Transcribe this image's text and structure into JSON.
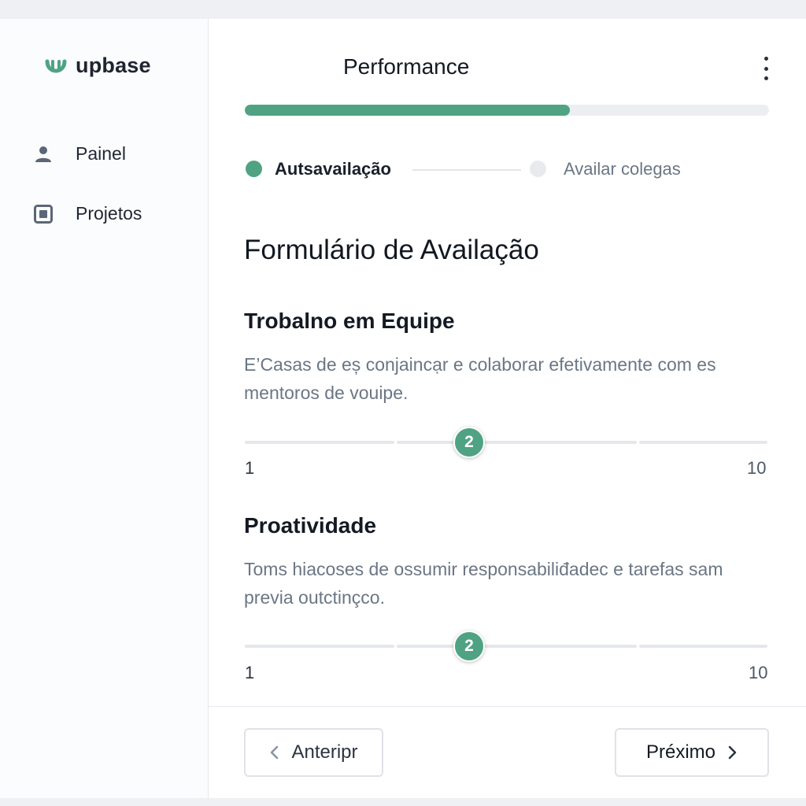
{
  "brand": {
    "name": "upbase",
    "accent": "#4fa383"
  },
  "sidebar": {
    "items": [
      {
        "label": "Painel",
        "icon": "user-icon"
      },
      {
        "label": "Projetos",
        "icon": "square-icon"
      }
    ]
  },
  "header": {
    "title": "Performance",
    "menu_icon": "kebab-menu-icon"
  },
  "progress": {
    "value_percent": 62,
    "color": "#4fa383"
  },
  "steps": [
    {
      "label": "Autsavailação",
      "state": "active"
    },
    {
      "label": "Availar colegas",
      "state": "pending"
    }
  ],
  "form": {
    "title": "Formulário de Availação",
    "criteria": [
      {
        "title": "Trobalno em Equipe",
        "description": "E’Casas de eș conjaincạr e colaborar efetivamente com es mentoros de vouipe.",
        "value": "2",
        "min": "1",
        "max": "10"
      },
      {
        "title": "Proatividade",
        "description": "Toms hiacoses de ossumir responsabiliđadec e tarefas sam previa outctinçco.",
        "value": "2",
        "min": "1",
        "max": "10"
      }
    ]
  },
  "footer": {
    "prev_label": "Anteripr",
    "next_label": "Préximo"
  }
}
